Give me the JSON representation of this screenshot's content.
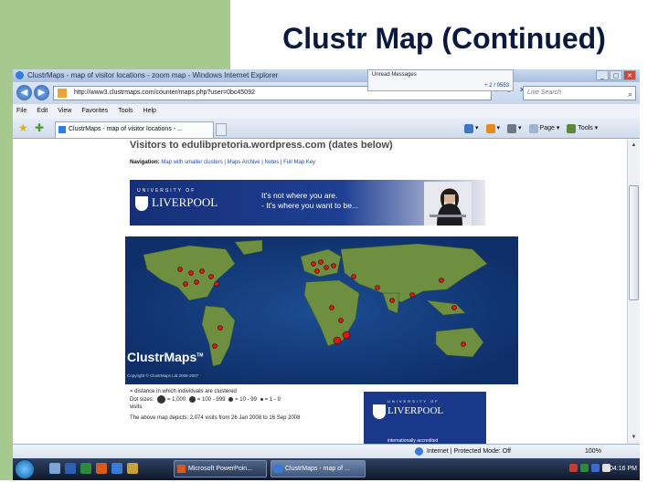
{
  "slide": {
    "title": "Clustr Map (Continued)"
  },
  "browser": {
    "window_title": "ClustrMaps - map of visitor locations - zoom map - Windows Internet Explorer",
    "window_buttons": [
      "_",
      "▢",
      "✕"
    ],
    "notification": {
      "title": "Unread Messages",
      "count": "+ 2 / 0553"
    },
    "back_icon": "back-arrow-icon",
    "forward_icon": "forward-arrow-icon",
    "address": "http://www3.clustrmaps.com/counter/maps.php?user=0bc45092",
    "address_tail": "▾ ↻ ✕",
    "search_placeholder": "Live Search",
    "search_icon": "search-icon",
    "menu": [
      "File",
      "Edit",
      "View",
      "Favorites",
      "Tools",
      "Help"
    ],
    "tab_label": "ClustrMaps - map of visitor locations - ...",
    "command_bar": {
      "page": "Page",
      "tools": "Tools"
    },
    "status": {
      "zone": "Internet | Protected Mode: Off",
      "zoom": "100%"
    }
  },
  "page": {
    "heading": "Visitors to edulibpretoria.wordpress.com (dates below)",
    "nav_label": "Navigation:",
    "nav_links": [
      "Map with smaller clusters",
      "Maps Archive",
      "Notes",
      "Full Map Key"
    ],
    "banner": {
      "university_word": "UNIVERSITY OF",
      "university_name": "LIVERPOOL",
      "slogan_line1": "It's not where you are.",
      "slogan_line2": "- It's where you want to be..."
    },
    "map": {
      "logo": "ClustrMaps",
      "tm": "TM",
      "copyright": "Copyright © ClustrMaps Ltd 2006-2007"
    },
    "legend": {
      "line1": "= distance in which individuals are clustered",
      "dot_sizes_label": "Dot sizes:",
      "sizes": [
        "= 1,000",
        "= 100 - 999",
        "= 10 - 99",
        "= 1 - 9"
      ],
      "visits": "visits",
      "summary": "The above map depicts: 2,074 visits from 26 Jan 2008 to 16 Sep 2008"
    },
    "banner2": {
      "university_word": "UNIVERSITY OF",
      "university_name": "LIVERPOOL",
      "accredited": "internationally accredited"
    }
  },
  "taskbar": {
    "tasks": [
      {
        "label": "Microsoft PowerPoin...",
        "active": false
      },
      {
        "label": "ClustrMaps - map of ...",
        "active": true
      }
    ],
    "clock": "04:16 PM"
  },
  "colors": {
    "slide_accent": "#a6c98d",
    "title_text": "#0b1a3c",
    "ie_chrome": "#c5d6ed",
    "map_ocean": "#1c4d92",
    "map_land": "#6d8f3f",
    "map_dot": "#d21b1b",
    "liverpool_blue": "#1a3889"
  }
}
